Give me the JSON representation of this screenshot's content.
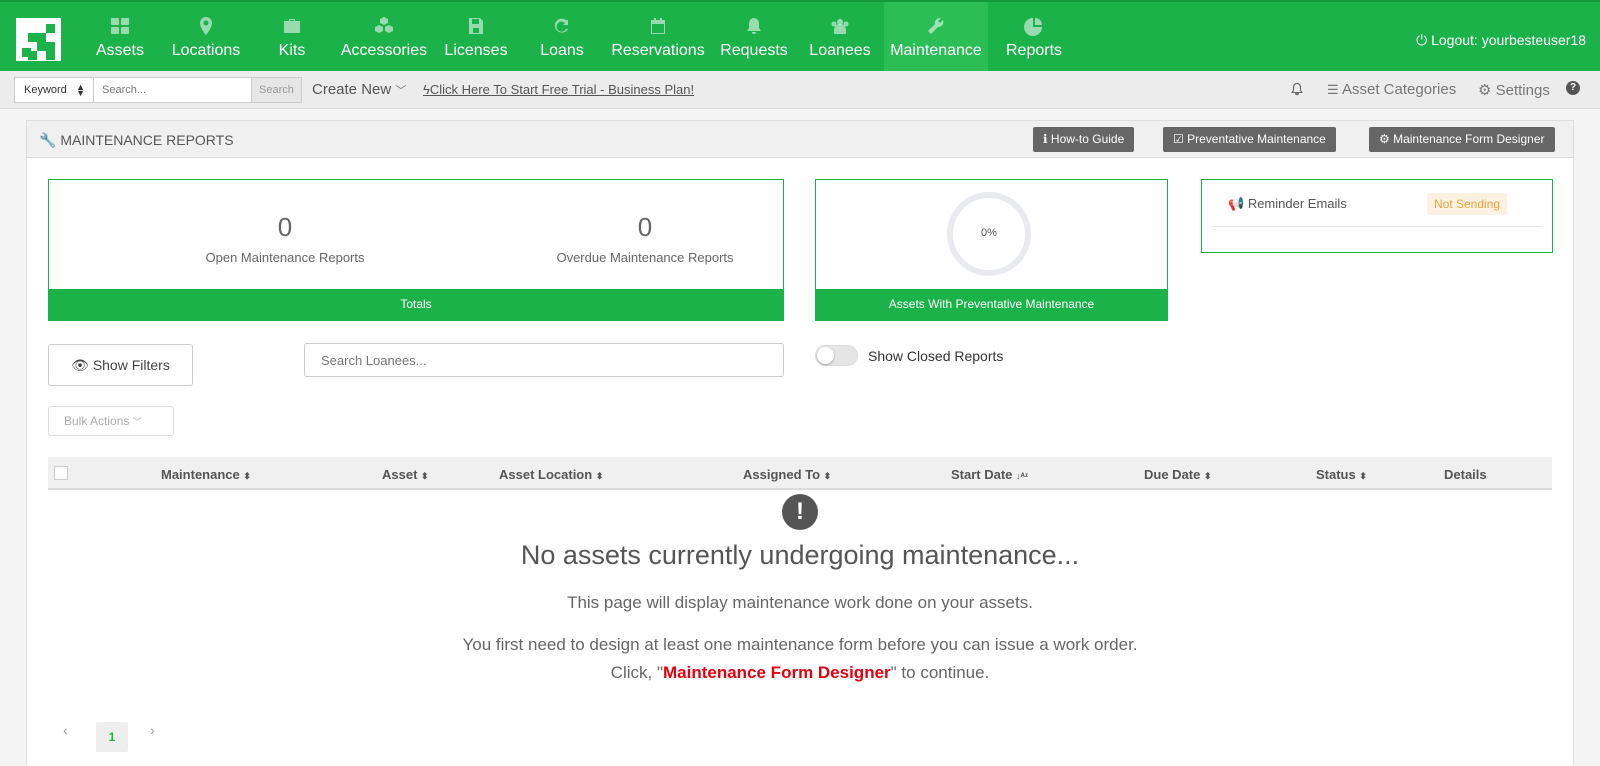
{
  "nav": {
    "items": [
      {
        "label": "Assets",
        "icon": "grid-icon"
      },
      {
        "label": "Locations",
        "icon": "map-pin-icon"
      },
      {
        "label": "Kits",
        "icon": "briefcase-icon"
      },
      {
        "label": "Accessories",
        "icon": "cubes-icon"
      },
      {
        "label": "Licenses",
        "icon": "save-icon"
      },
      {
        "label": "Loans",
        "icon": "refresh-icon"
      },
      {
        "label": "Reservations",
        "icon": "calendar-icon"
      },
      {
        "label": "Requests",
        "icon": "bell-icon"
      },
      {
        "label": "Loanees",
        "icon": "users-icon"
      },
      {
        "label": "Maintenance",
        "icon": "wrench-icon",
        "active": true
      },
      {
        "label": "Reports",
        "icon": "pie-chart-icon"
      }
    ],
    "logout": "Logout: yourbesteuser18"
  },
  "subbar": {
    "keyword": "Keyword",
    "search_placeholder": "Search...",
    "search_button": "Search",
    "create_new": "Create New",
    "free_trial": "Click Here To Start Free Trial - Business Plan!",
    "asset_categories": "Asset Categories",
    "settings": "Settings",
    "help": "?"
  },
  "panel": {
    "title": "MAINTENANCE REPORTS",
    "howto": "How-to Guide",
    "preventative": "Preventative Maintenance",
    "form_designer": "Maintenance Form Designer"
  },
  "totals": {
    "open_count": "0",
    "open_label": "Open Maintenance Reports",
    "overdue_count": "0",
    "overdue_label": "Overdue Maintenance Reports",
    "footer": "Totals"
  },
  "preventative": {
    "percent": "0%",
    "footer": "Assets With Preventative Maintenance"
  },
  "reminder": {
    "label": "Reminder Emails",
    "status": "Not Sending"
  },
  "filters": {
    "show_filters": "Show Filters",
    "search_loanees_placeholder": "Search Loanees...",
    "show_closed": "Show Closed Reports",
    "bulk_actions": "Bulk Actions"
  },
  "table": {
    "columns": [
      "Maintenance",
      "Asset",
      "Asset Location",
      "Assigned To",
      "Start Date",
      "Due Date",
      "Status",
      "Details"
    ]
  },
  "empty": {
    "title": "No assets currently undergoing maintenance...",
    "line1": "This page will display maintenance work done on your assets.",
    "line2": "You first need to design at least one maintenance form before you can issue a work order.",
    "line3_prefix": "Click, \"",
    "line3_link": "Maintenance Form Designer",
    "line3_suffix": "\" to continue."
  },
  "pagination": {
    "current": "1"
  },
  "colors": {
    "brand_green": "#1cb24a",
    "warning_text": "#e8a23b",
    "link_red": "#e3000f"
  }
}
